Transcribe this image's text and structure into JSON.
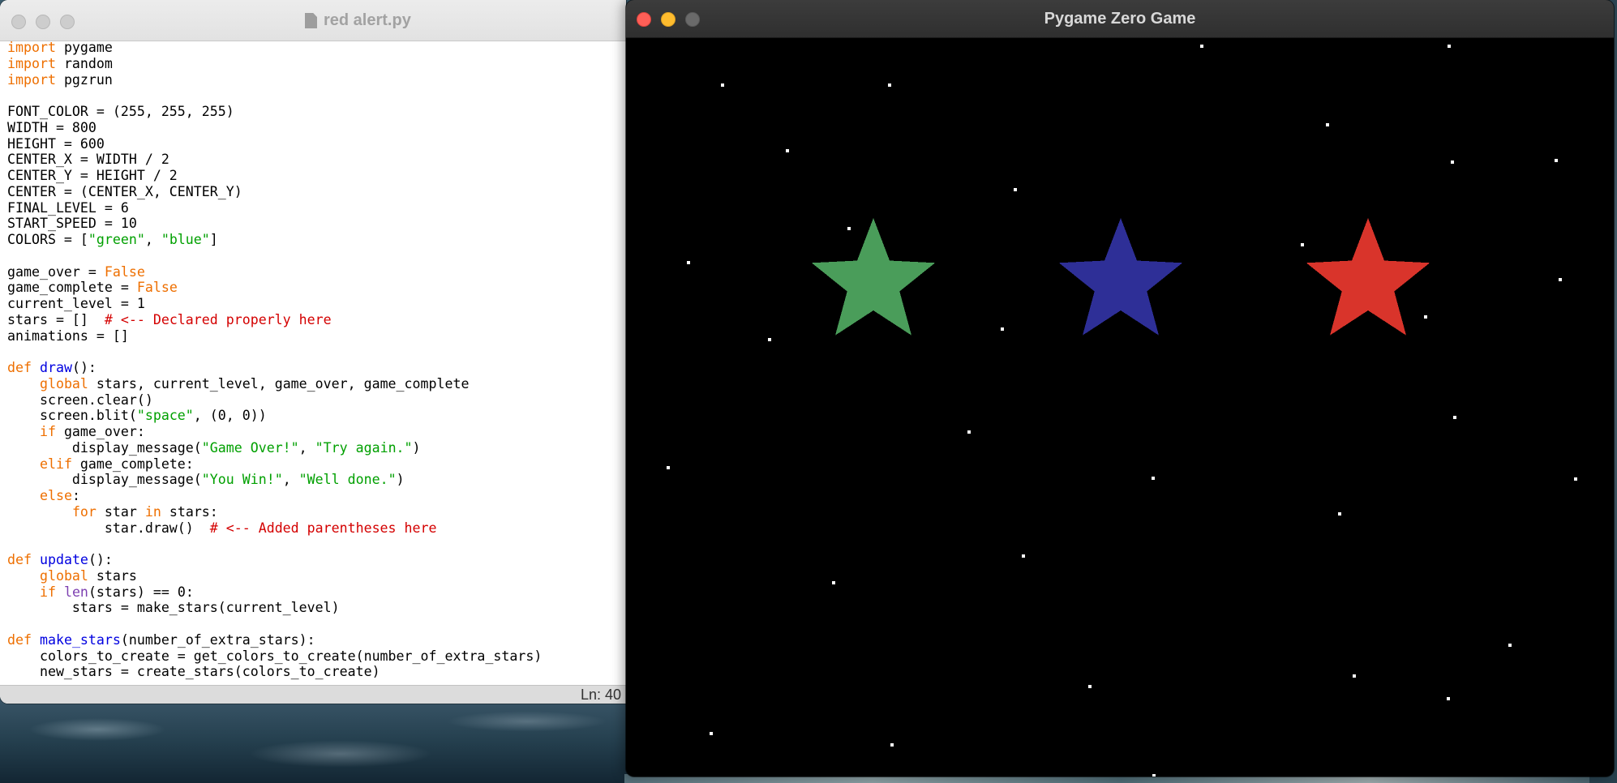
{
  "editor": {
    "title": "red alert.py",
    "status": "Ln: 40",
    "lines": [
      [
        {
          "t": "kw",
          "v": "import"
        },
        {
          "t": "",
          "v": " pygame"
        }
      ],
      [
        {
          "t": "kw",
          "v": "import"
        },
        {
          "t": "",
          "v": " random"
        }
      ],
      [
        {
          "t": "kw",
          "v": "import"
        },
        {
          "t": "",
          "v": " pgzrun"
        }
      ],
      [],
      [
        {
          "t": "",
          "v": "FONT_COLOR = (255, 255, 255)"
        }
      ],
      [
        {
          "t": "",
          "v": "WIDTH = 800"
        }
      ],
      [
        {
          "t": "",
          "v": "HEIGHT = 600"
        }
      ],
      [
        {
          "t": "",
          "v": "CENTER_X = WIDTH / 2"
        }
      ],
      [
        {
          "t": "",
          "v": "CENTER_Y = HEIGHT / 2"
        }
      ],
      [
        {
          "t": "",
          "v": "CENTER = (CENTER_X, CENTER_Y)"
        }
      ],
      [
        {
          "t": "",
          "v": "FINAL_LEVEL = 6"
        }
      ],
      [
        {
          "t": "",
          "v": "START_SPEED = 10"
        }
      ],
      [
        {
          "t": "",
          "v": "COLORS = ["
        },
        {
          "t": "str",
          "v": "\"green\""
        },
        {
          "t": "",
          "v": ", "
        },
        {
          "t": "str",
          "v": "\"blue\""
        },
        {
          "t": "",
          "v": "]"
        }
      ],
      [],
      [
        {
          "t": "",
          "v": "game_over = "
        },
        {
          "t": "kw",
          "v": "False"
        }
      ],
      [
        {
          "t": "",
          "v": "game_complete = "
        },
        {
          "t": "kw",
          "v": "False"
        }
      ],
      [
        {
          "t": "",
          "v": "current_level = 1"
        }
      ],
      [
        {
          "t": "",
          "v": "stars = []  "
        },
        {
          "t": "cm",
          "v": "# <-- Declared properly here"
        }
      ],
      [
        {
          "t": "",
          "v": "animations = []"
        }
      ],
      [],
      [
        {
          "t": "kw",
          "v": "def"
        },
        {
          "t": "",
          "v": " "
        },
        {
          "t": "fn",
          "v": "draw"
        },
        {
          "t": "",
          "v": "():"
        }
      ],
      [
        {
          "t": "",
          "v": "    "
        },
        {
          "t": "kw",
          "v": "global"
        },
        {
          "t": "",
          "v": " stars, current_level, game_over, game_complete"
        }
      ],
      [
        {
          "t": "",
          "v": "    screen.clear()"
        }
      ],
      [
        {
          "t": "",
          "v": "    screen.blit("
        },
        {
          "t": "str",
          "v": "\"space\""
        },
        {
          "t": "",
          "v": ", (0, 0))"
        }
      ],
      [
        {
          "t": "",
          "v": "    "
        },
        {
          "t": "kw",
          "v": "if"
        },
        {
          "t": "",
          "v": " game_over:"
        }
      ],
      [
        {
          "t": "",
          "v": "        display_message("
        },
        {
          "t": "str",
          "v": "\"Game Over!\""
        },
        {
          "t": "",
          "v": ", "
        },
        {
          "t": "str",
          "v": "\"Try again.\""
        },
        {
          "t": "",
          "v": ")"
        }
      ],
      [
        {
          "t": "",
          "v": "    "
        },
        {
          "t": "kw",
          "v": "elif"
        },
        {
          "t": "",
          "v": " game_complete:"
        }
      ],
      [
        {
          "t": "",
          "v": "        display_message("
        },
        {
          "t": "str",
          "v": "\"You Win!\""
        },
        {
          "t": "",
          "v": ", "
        },
        {
          "t": "str",
          "v": "\"Well done.\""
        },
        {
          "t": "",
          "v": ")"
        }
      ],
      [
        {
          "t": "",
          "v": "    "
        },
        {
          "t": "kw",
          "v": "else"
        },
        {
          "t": "",
          "v": ":"
        }
      ],
      [
        {
          "t": "",
          "v": "        "
        },
        {
          "t": "kw",
          "v": "for"
        },
        {
          "t": "",
          "v": " star "
        },
        {
          "t": "kw",
          "v": "in"
        },
        {
          "t": "",
          "v": " stars:"
        }
      ],
      [
        {
          "t": "",
          "v": "            star.draw()  "
        },
        {
          "t": "cm",
          "v": "# <-- Added parentheses here"
        }
      ],
      [],
      [
        {
          "t": "kw",
          "v": "def"
        },
        {
          "t": "",
          "v": " "
        },
        {
          "t": "fn",
          "v": "update"
        },
        {
          "t": "",
          "v": "():"
        }
      ],
      [
        {
          "t": "",
          "v": "    "
        },
        {
          "t": "kw",
          "v": "global"
        },
        {
          "t": "",
          "v": " stars"
        }
      ],
      [
        {
          "t": "",
          "v": "    "
        },
        {
          "t": "kw",
          "v": "if"
        },
        {
          "t": "",
          "v": " "
        },
        {
          "t": "bi",
          "v": "len"
        },
        {
          "t": "",
          "v": "(stars) == 0:"
        }
      ],
      [
        {
          "t": "",
          "v": "        stars = make_stars(current_level)"
        }
      ],
      [],
      [
        {
          "t": "kw",
          "v": "def"
        },
        {
          "t": "",
          "v": " "
        },
        {
          "t": "fn",
          "v": "make_stars"
        },
        {
          "t": "",
          "v": "(number_of_extra_stars):"
        }
      ],
      [
        {
          "t": "",
          "v": "    colors_to_create = get_colors_to_create(number_of_extra_stars)"
        }
      ],
      [
        {
          "t": "",
          "v": "    new_stars = create_stars(colors_to_create)"
        }
      ]
    ]
  },
  "game": {
    "title": "Pygame Zero Game",
    "stars": [
      {
        "name": "green-star",
        "color": "#4a9d5a"
      },
      {
        "name": "blue-star",
        "color": "#2e2f97"
      },
      {
        "name": "red-star",
        "color": "#d9342b"
      }
    ]
  }
}
